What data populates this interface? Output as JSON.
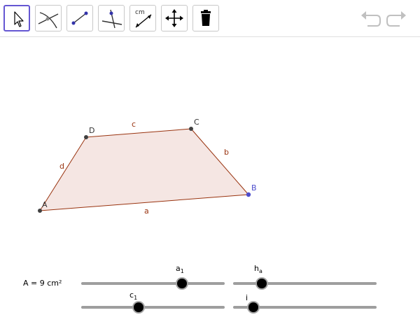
{
  "toolbar": {
    "tools": [
      {
        "name": "move-tool",
        "selected": true
      },
      {
        "name": "intersect-tool",
        "selected": false
      },
      {
        "name": "segment-tool",
        "selected": false
      },
      {
        "name": "perpendicular-tool",
        "selected": false
      },
      {
        "name": "segment-length-tool",
        "label": "cm",
        "selected": false
      },
      {
        "name": "move-graphics-tool",
        "selected": false
      },
      {
        "name": "delete-tool",
        "selected": false
      }
    ]
  },
  "figure": {
    "points": {
      "A": "A",
      "B": "B",
      "C": "C",
      "D": "D"
    },
    "sides": {
      "a": "a",
      "b": "b",
      "c": "c",
      "d": "d"
    },
    "fill_color": "#f5e6e3",
    "edge_color": "#99330f",
    "point_color": "#404040",
    "point_B_color": "#4d4dcc"
  },
  "area": {
    "text": "A = 9 cm²"
  },
  "sliders": [
    {
      "id": "a1",
      "base": "a",
      "sub": "1",
      "fraction": 0.7
    },
    {
      "id": "ha",
      "base": "h",
      "sub": "a",
      "fraction": 0.2
    },
    {
      "id": "c1",
      "base": "c",
      "sub": "1",
      "fraction": 0.4
    },
    {
      "id": "i",
      "base": "i",
      "sub": "",
      "fraction": 0.14
    }
  ]
}
